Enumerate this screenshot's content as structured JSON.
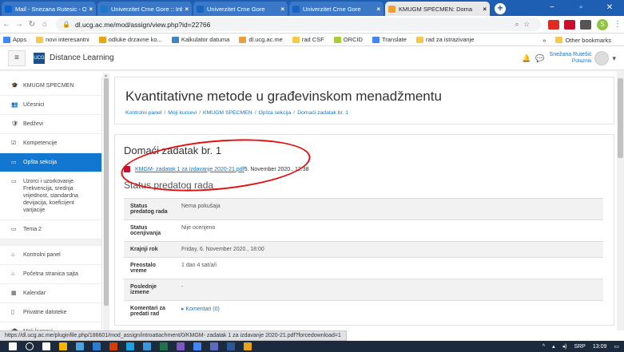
{
  "browser": {
    "tabs": [
      {
        "title": "Mail - Snezana Rutesic - Ou",
        "color": "#0a64d0",
        "active": false
      },
      {
        "title": "Univerzitet Crne Gore :: Inb",
        "color": "#1c79c9",
        "active": false
      },
      {
        "title": "Univerzitet Crne Gore",
        "color": "#1565c0",
        "active": false
      },
      {
        "title": "Univerzitet Crne Gore",
        "color": "#1565c0",
        "active": false
      },
      {
        "title": "KMUGM SPECMEN: Doma",
        "color": "#f0a030",
        "active": true
      }
    ],
    "url": "dl.ucg.ac.me/mod/assign/view.php?id=22766",
    "profile_letter": "S"
  },
  "bookmarks": {
    "items": [
      {
        "label": "Apps",
        "color": "#4285f4"
      },
      {
        "label": "novi interesantni",
        "color": "#f7c948"
      },
      {
        "label": "odluke drzavne ko...",
        "color": "#e8a317"
      },
      {
        "label": "Kalkulator datuma",
        "color": "#3a86c8"
      },
      {
        "label": "dl.ucg.ac.me",
        "color": "#f0a030"
      },
      {
        "label": "rad CSF",
        "color": "#f7c948"
      },
      {
        "label": "ORCID",
        "color": "#a6ce39"
      },
      {
        "label": "Translate",
        "color": "#4285f4"
      },
      {
        "label": "rad za istrazivanje",
        "color": "#f7c948"
      }
    ],
    "more": "»",
    "other": "Other bookmarks"
  },
  "moodle": {
    "brand": "Distance Learning",
    "logo_text": "UCG",
    "user_name": "Snežana Rutešić",
    "user_role": "Polaznik"
  },
  "sidebar": {
    "items": [
      {
        "icon": "🎓",
        "label": "KMUGM SPECMEN",
        "active": false
      },
      {
        "icon": "👥",
        "label": "Učesnici",
        "active": false
      },
      {
        "icon": "🛡",
        "label": "Bedževi",
        "active": false
      },
      {
        "icon": "☑",
        "label": "Kompetencije",
        "active": false
      },
      {
        "icon": "▭",
        "label": "Opšta sekcija",
        "active": true
      },
      {
        "icon": "▭",
        "label": "Uzorci i uzorkovanje. Frekvencija, srednja vrijednost, standardna devijacija, koeficijent varijacije",
        "active": false
      },
      {
        "icon": "▭",
        "label": "Tema 2",
        "active": false
      }
    ],
    "items2": [
      {
        "icon": "⌂",
        "label": "Kontrolni panel"
      },
      {
        "icon": "⌂",
        "label": "Početna stranica sajta"
      },
      {
        "icon": "▦",
        "label": "Kalendar"
      },
      {
        "icon": "▯",
        "label": "Privatne datoteke"
      },
      {
        "icon": "🎓",
        "label": "Moji kursevi"
      }
    ]
  },
  "main": {
    "title": "Kvantitativne metode u građevinskom menadžmentu",
    "breadcrumbs": [
      "Kontrolni panel",
      "Moji kursevi",
      "KMUGM SPECMEN",
      "Opšta sekcija",
      "Domaći zadatak br. 1"
    ],
    "assignment_title": "Domaći zadatak br. 1",
    "attachment_name": "KMGM- zadatak 1 za izdavanje 2020-21.pdf",
    "attachment_date": "5. November 2020., 12:38",
    "status_heading": "Status predatog rada",
    "rows": [
      {
        "label": "Status predatog rada",
        "value": "Nema pokušaja",
        "link": false
      },
      {
        "label": "Status ocenjivanja",
        "value": "Nije ocenjeno",
        "link": false
      },
      {
        "label": "Krajnji rok",
        "value": "Friday, 6. November 2020., 18:00",
        "link": false
      },
      {
        "label": "Preostalo vreme",
        "value": "1 dan 4 sat/a/i",
        "link": false
      },
      {
        "label": "Poslednje izmene",
        "value": "-",
        "link": false
      },
      {
        "label": "Komentari za predati rad",
        "value": "▸  Komentari (0)",
        "link": true
      }
    ]
  },
  "status_bar": "https://dl.ucg.ac.me/pluginfile.php/186601/mod_assign/introattachment/0/KMGM- zadatak 1 za izdavanje 2020-21.pdf?forcedownload=1",
  "taskbar": {
    "icons": [
      "#ffffff",
      "#ffffff",
      "#ffffff",
      "#f7b500",
      "#4aa3df",
      "#2b7cd3",
      "#d83b01",
      "#1ba1e2",
      "#3a96dd",
      "#217346",
      "#7e57c2",
      "#4285f4",
      "#5c6bc0",
      "#2b579a",
      "#e8a317"
    ],
    "lang": "SRP",
    "time": "13:09"
  }
}
